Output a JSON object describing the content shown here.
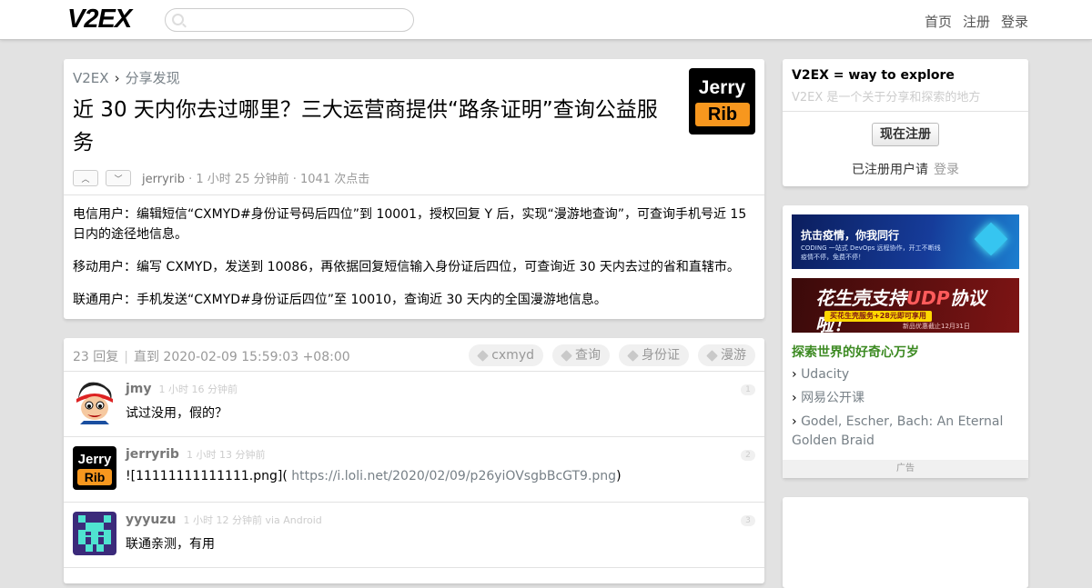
{
  "header": {
    "logo": "V2EX",
    "search_value": "",
    "nav": [
      "首页",
      "注册",
      "登录"
    ]
  },
  "topic": {
    "breadcrumb": [
      "V2EX",
      "›",
      "分享发现"
    ],
    "title": "近 30 天内你去过哪里？三大运营商提供“路条证明”查询公益服务",
    "avatar": {
      "line1": "Jerry",
      "line2": "Rib",
      "accent": "#f7971e"
    },
    "meta": {
      "author": "jerryrib",
      "time": " · 1 小时 25 分钟前 · ",
      "views": "1041 次点击"
    },
    "content": [
      "电信用户：编辑短信“CXMYD#身份证号码后四位”到 10001，授权回复 Y 后，实现“漫游地查询”，可查询手机号近 15 日内的途径地信息。",
      "移动用户：编写 CXMYD，发送到 10086，再依据回复短信输入身份证后四位，可查询近 30 天内去过的省和直辖市。",
      "联通用户：手机发送“CXMYD#身份证后四位”至 10010，查询近 30 天内的全国漫游地信息。"
    ]
  },
  "replies_header": {
    "count": "23 回复",
    "separator": "|",
    "until": "直到 2020-02-09 15:59:03 +08:00",
    "tags": [
      "cxmyd",
      "查询",
      "身份证",
      "漫游"
    ]
  },
  "replies": [
    {
      "name": "jmy",
      "time": "1 小时 16 分钟前",
      "text": "试过没用，假的？",
      "num": "1"
    },
    {
      "name": "jerryrib",
      "time": "1 小时 13 分钟前",
      "text_pre": "![11111111111111.png](",
      "link": "https://i.loli.net/2020/02/09/p26yiOVsgbBcGT9.png",
      "text_post": ")",
      "num": "2"
    },
    {
      "name": "yyyuzu",
      "time": "1 小时 12 分钟前 via Android",
      "text": "联通亲测，有用",
      "num": "3"
    }
  ],
  "sidebar": {
    "welcome_title": "V2EX = way to explore",
    "welcome_sub": "V2EX 是一个关于分享和探索的地方",
    "register_button": "现在注册",
    "registered_text": "已注册用户请",
    "login_link": "登录",
    "banner1": {
      "title": "抗击疫情，你我同行",
      "sub1": "CODING 一站式 DevOps 远程协作，开工不断线",
      "sub2": "疫情不停，免费不停！"
    },
    "banner2": {
      "pre": "花生壳支持",
      "udp": "UDP",
      "post": "协议啦！",
      "badge": "买花生壳服务+28元即可享用",
      "date": "新品优惠截止12月31日"
    },
    "explore_title": "探索世界的好奇心万岁",
    "links": [
      "Udacity",
      "网易公开课",
      "Godel, Escher, Bach: An Eternal Golden Braid"
    ],
    "ad_label": "广告"
  }
}
